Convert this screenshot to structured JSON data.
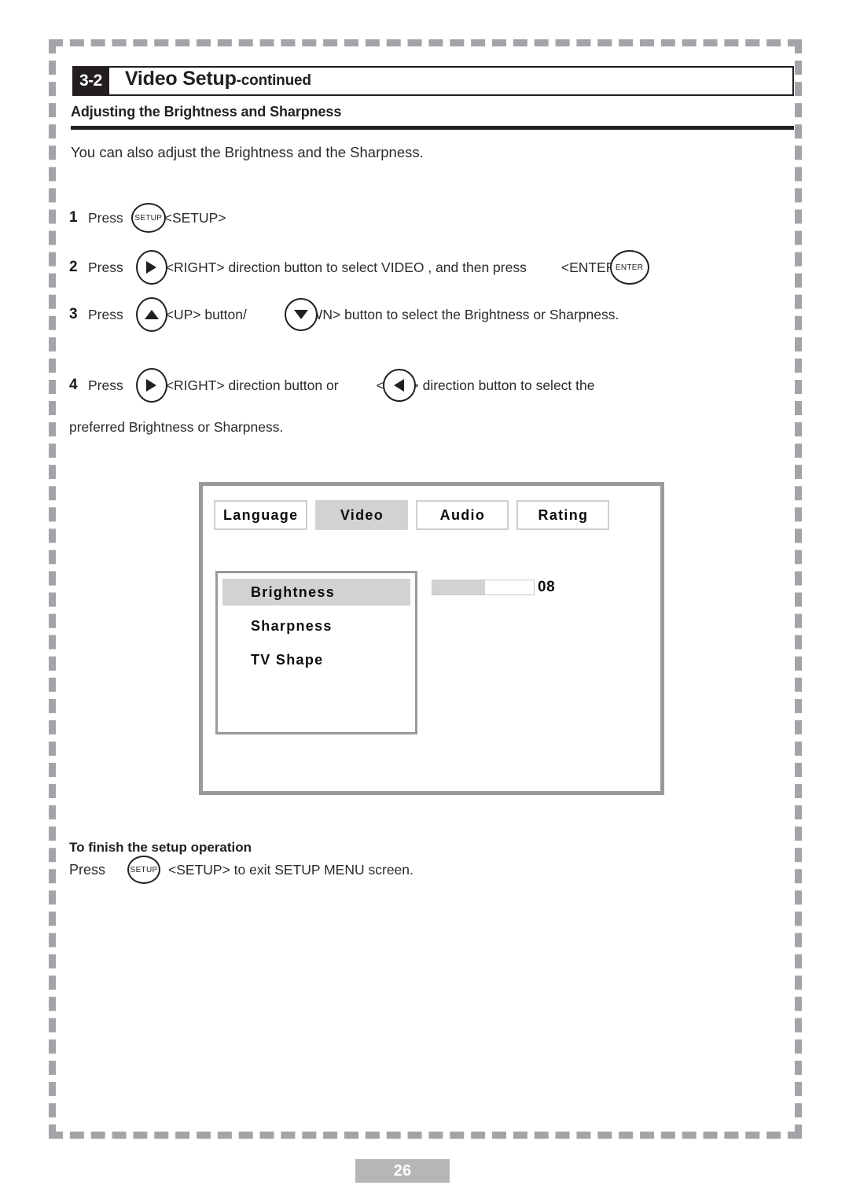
{
  "header": {
    "section_number": "3-2",
    "title_main": "Video Setup",
    "title_suffix": "-continued",
    "subheading": "Adjusting the Brightness and Sharpness"
  },
  "intro": "You can also adjust the Brightness and the Sharpness.",
  "steps": [
    {
      "number": "1",
      "press_label": "Press",
      "key1": "SETUP",
      "text1": "<SETUP>"
    },
    {
      "number": "2",
      "press_label": "Press",
      "key1": "RIGHT",
      "text1": "<RIGHT> direction button to select  VIDEO , and then press",
      "text2": "<ENTER>",
      "key2": "ENTER"
    },
    {
      "number": "3",
      "press_label": "Press",
      "key1": "UP",
      "text1": "<UP> button/",
      "key2": "DOWN",
      "text2": "WN> button to select the Brightness or Sharpness."
    },
    {
      "number": "4",
      "press_label": "Press",
      "key1": "RIGHT",
      "text1": "<RIGHT> direction button or",
      "text_left_prefix": "<L",
      "key2": "LEFT",
      "text2": "> direction button to select the",
      "continuation": "preferred Brightness or Sharpness."
    }
  ],
  "osd": {
    "tabs": [
      {
        "label": "Language",
        "active": false
      },
      {
        "label": "Video",
        "active": true
      },
      {
        "label": "Audio",
        "active": false
      },
      {
        "label": "Rating",
        "active": false
      }
    ],
    "menu_items": [
      {
        "label": "Brightness",
        "selected": true
      },
      {
        "label": "Sharpness",
        "selected": false
      },
      {
        "label": "TV Shape",
        "selected": false
      }
    ],
    "value": "08",
    "bar_percent": 52
  },
  "footer": {
    "finish_heading": "To finish the setup operation",
    "press_label": "Press",
    "key": "SETUP",
    "text_after_key": "<SETUP>   to exit SETUP MENU screen."
  },
  "page_number": "26",
  "colors": {
    "ink": "#231f20",
    "dash_border": "#a3a3a8",
    "osd_frame": "#9a9a9a",
    "highlight": "#d2d2d2",
    "page_tag_bg": "#b6b6b6"
  }
}
